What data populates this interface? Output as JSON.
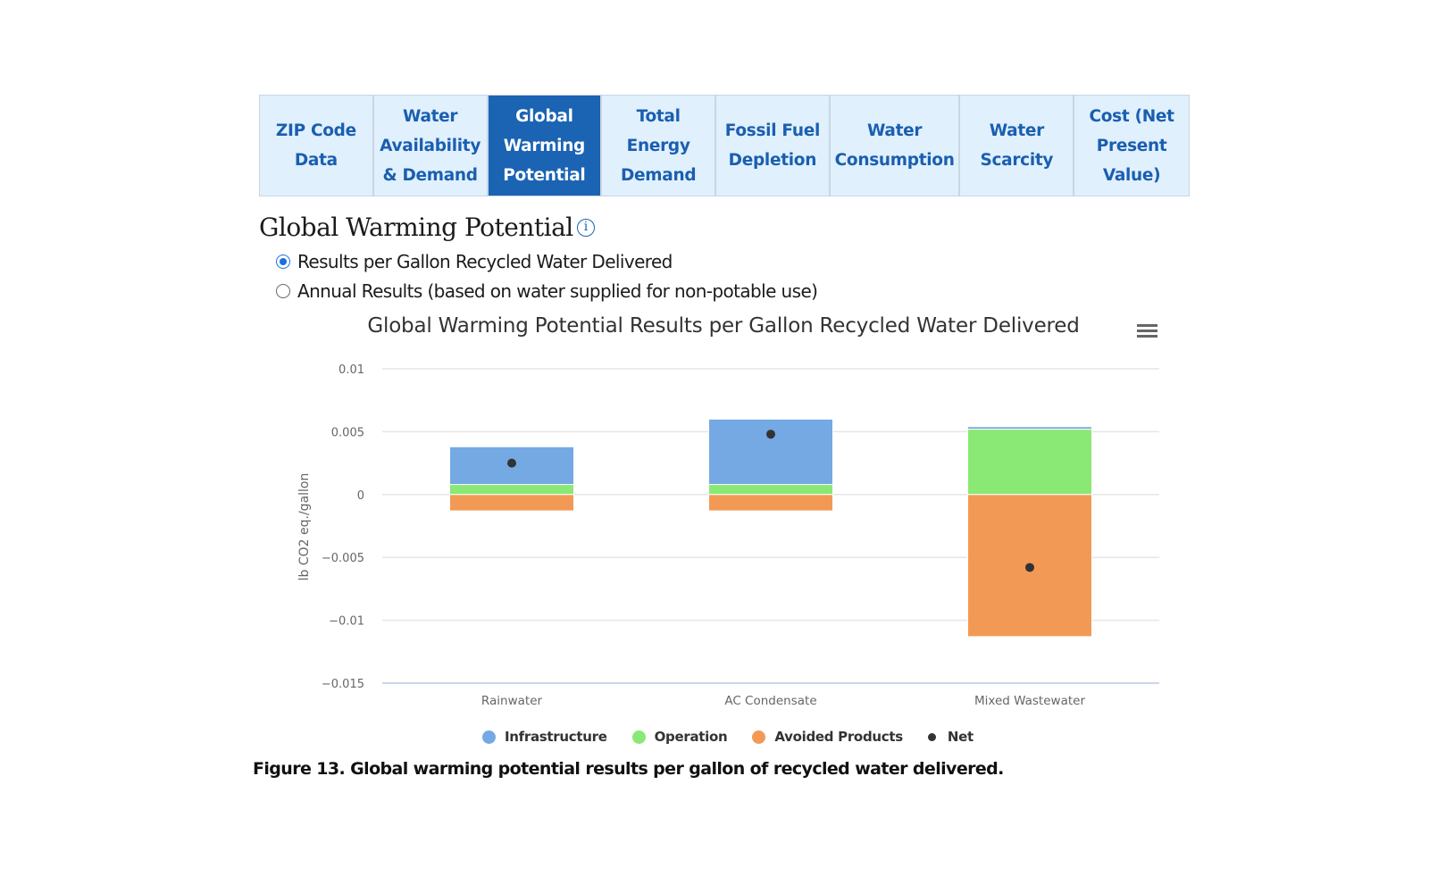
{
  "tabs": [
    {
      "label": "ZIP Code\nData",
      "active": false
    },
    {
      "label": "Water\nAvailability\n& Demand",
      "active": false
    },
    {
      "label": "Global\nWarming\nPotential",
      "active": true
    },
    {
      "label": "Total\nEnergy\nDemand",
      "active": false
    },
    {
      "label": "Fossil Fuel\nDepletion",
      "active": false
    },
    {
      "label": "Water\nConsumption",
      "active": false
    },
    {
      "label": "Water\nScarcity",
      "active": false
    },
    {
      "label": "Cost (Net\nPresent\nValue)",
      "active": false
    }
  ],
  "section": {
    "heading": "Global Warming Potential",
    "info_icon": "i",
    "options": [
      {
        "label": "Results per Gallon Recycled Water Delivered",
        "checked": true
      },
      {
        "label": "Annual Results (based on water supplied for non-potable use)",
        "checked": false
      }
    ]
  },
  "caption": "Figure 13. Global warming potential results per gallon of recycled water delivered.",
  "colors": {
    "infrastructure": "#74a9e3",
    "operation": "#8ae875",
    "avoided": "#f29a55",
    "net": "#333333",
    "active_tab": "#1b63b3",
    "tab_bg": "#e1f0fd"
  },
  "chart_data": {
    "type": "bar",
    "stacked": true,
    "title": "Global Warming Potential Results per Gallon Recycled Water Delivered",
    "xlabel": "",
    "ylabel": "lb CO2 eq./gallon",
    "ylim": [
      -0.015,
      0.01
    ],
    "yticks": [
      0.01,
      0.005,
      0,
      -0.005,
      -0.01,
      -0.015
    ],
    "ytick_labels": [
      "0.01",
      "0.005",
      "0",
      "−0.005",
      "−0.01",
      "−0.015"
    ],
    "grid": true,
    "legend_position": "bottom-center",
    "categories": [
      "Rainwater",
      "AC Condensate",
      "Mixed Wastewater"
    ],
    "series": [
      {
        "name": "Infrastructure",
        "type": "bar",
        "values": [
          0.003,
          0.0052,
          0.0002
        ]
      },
      {
        "name": "Operation",
        "type": "bar",
        "values": [
          0.0008,
          0.0008,
          0.0052
        ]
      },
      {
        "name": "Avoided Products",
        "type": "bar",
        "values": [
          -0.0013,
          -0.0013,
          -0.0113
        ]
      },
      {
        "name": "Net",
        "type": "scatter",
        "values": [
          0.0025,
          0.0048,
          -0.0058
        ]
      }
    ]
  }
}
